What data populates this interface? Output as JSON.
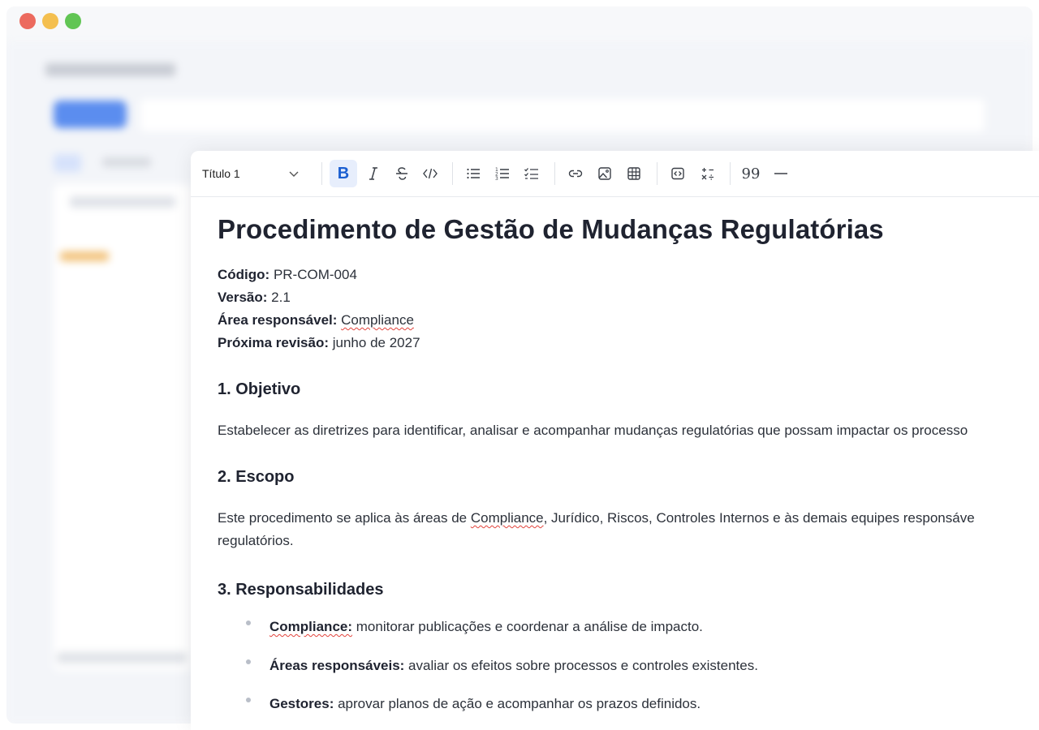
{
  "toolbar": {
    "heading_select": "Título 1",
    "quote_label": "99",
    "buttons": [
      "bold-icon",
      "italic-icon",
      "strikethrough-icon",
      "code-icon",
      "bullet-list-icon",
      "numbered-list-icon",
      "checklist-icon",
      "link-icon",
      "image-icon",
      "table-icon",
      "embed-icon",
      "math-icon",
      "quote-icon",
      "horizontal-rule-icon"
    ],
    "accent_color": "#1b5fd1"
  },
  "document": {
    "title": "Procedimento de Gestão de Mudanças Regulatórias",
    "meta": [
      {
        "label": "Código:",
        "value": "PR-COM-004"
      },
      {
        "label": "Versão:",
        "value": "2.1"
      },
      {
        "label": "Área responsável:",
        "value": "Compliance"
      },
      {
        "label": "Próxima revisão:",
        "value": "junho de 2027"
      }
    ],
    "sections": [
      {
        "heading": "1. Objetivo",
        "text": "Estabelecer as diretrizes para identificar, analisar e acompanhar mudanças regulatórias que possam impactar os processo"
      },
      {
        "heading": "2. Escopo",
        "text_prefix": "Este procedimento se aplica às áreas de ",
        "text_spell": "Compliance",
        "text_suffix": ", Jurídico, Riscos, Controles Internos e às demais equipes responsáve",
        "text_line2": "regulatórios."
      },
      {
        "heading": "3. Responsabilidades"
      }
    ],
    "responsibilities": [
      {
        "label": "Compliance:",
        "text": " monitorar publicações e coordenar a análise de impacto."
      },
      {
        "label": "Áreas responsáveis:",
        "text": " avaliar os efeitos sobre processos e controles existentes."
      },
      {
        "label": "Gestores:",
        "text": " aprovar planos de ação e acompanhar os prazos definidos."
      }
    ]
  }
}
